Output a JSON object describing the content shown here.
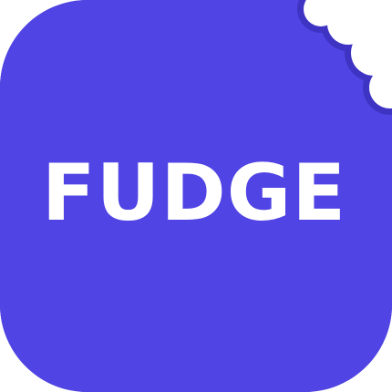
{
  "logo": {
    "wordmark": "FUDGE",
    "colors": {
      "background": "#5044E4",
      "bite_rim": "#3F33C4",
      "text": "#FFFFFF",
      "page": "#FFFFFF"
    },
    "icon": "bitten-rounded-square-icon"
  }
}
